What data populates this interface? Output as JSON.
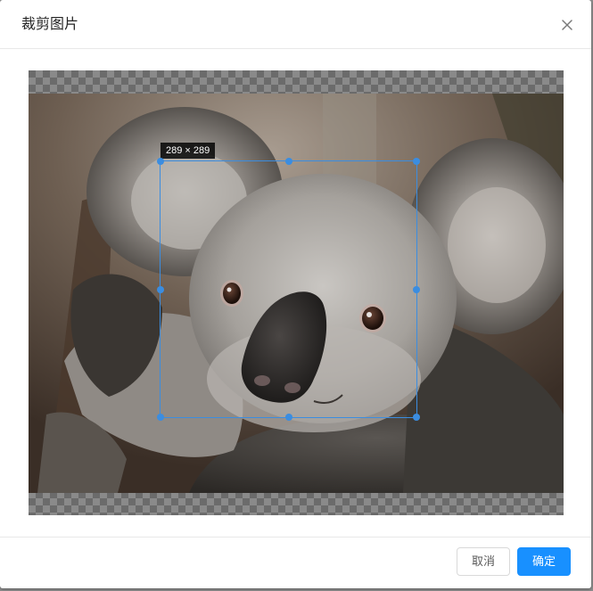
{
  "dialog": {
    "title": "裁剪图片"
  },
  "cropper": {
    "size_label": "289 × 289",
    "selection_width": 289,
    "selection_height": 289
  },
  "footer": {
    "cancel_label": "取消",
    "confirm_label": "确定"
  },
  "colors": {
    "accent": "#1890ff",
    "crop_outline": "#3b8de0"
  },
  "icons": {
    "close": "close-icon"
  }
}
